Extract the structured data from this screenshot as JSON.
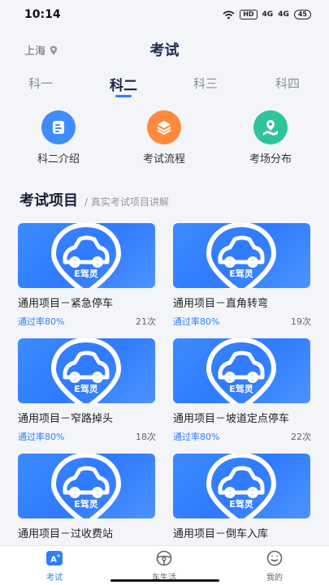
{
  "status": {
    "time": "10:14",
    "hd": "HD",
    "signal1": "4G",
    "signal2": "4G",
    "battery": "45"
  },
  "header": {
    "city": "上海",
    "title": "考试"
  },
  "tabs": [
    {
      "label": "科一"
    },
    {
      "label": "科二"
    },
    {
      "label": "科三"
    },
    {
      "label": "科四"
    }
  ],
  "quick": [
    {
      "label": "科二介绍",
      "color": "#3f8cff"
    },
    {
      "label": "考试流程",
      "color": "#ff8a3d"
    },
    {
      "label": "考场分布",
      "color": "#2fc49a"
    }
  ],
  "section": {
    "title": "考试项目",
    "subtitle": "/ 真实考试项目讲解"
  },
  "card_logo_text": "E驾灵",
  "cards": [
    {
      "title": "通用项目－紧急停车",
      "pass": "通过率80%",
      "count": "21次"
    },
    {
      "title": "通用项目－直角转弯",
      "pass": "通过率80%",
      "count": "19次"
    },
    {
      "title": "通用项目－窄路掉头",
      "pass": "通过率80%",
      "count": "18次"
    },
    {
      "title": "通用项目－坡道定点停车",
      "pass": "通过率80%",
      "count": "22次"
    },
    {
      "title": "通用项目－过收费站",
      "pass": "",
      "count": ""
    },
    {
      "title": "通用项目－倒车入库",
      "pass": "",
      "count": ""
    }
  ],
  "nav": [
    {
      "label": "考试",
      "icon": "exam-icon"
    },
    {
      "label": "车生活",
      "icon": "steering-wheel-icon"
    },
    {
      "label": "我的",
      "icon": "smiley-icon"
    }
  ],
  "colors": {
    "accent": "#2f7dff",
    "title": "#1a2450"
  }
}
